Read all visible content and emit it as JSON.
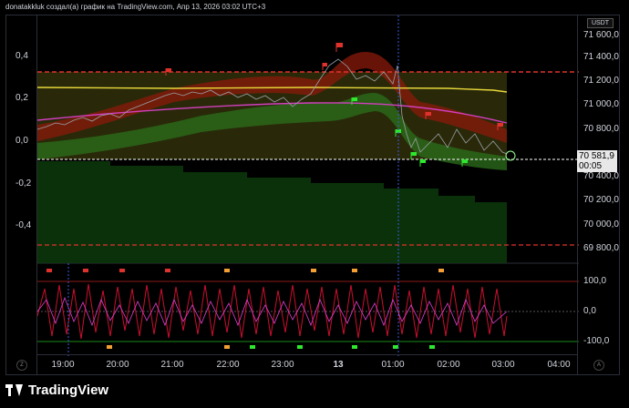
{
  "caption": "donatakkluk создал(а) график на TradingView.com, Апр 13, 2026 03:02 UTC+3",
  "currency": "USDT",
  "price_scale": [
    "71 600,0",
    "71 400,0",
    "71 200,0",
    "71 000,0",
    "70 800,0",
    "70 400,0",
    "70 200,0",
    "70 000,0",
    "69 800,0"
  ],
  "price_tag": {
    "price": "70 581,9",
    "countdown": "00:05"
  },
  "left_scale": [
    "0,4",
    "0,2",
    "0,0",
    "-0,2",
    "-0,4"
  ],
  "oscillator_scale": [
    "100,0",
    "0,0",
    "-100,0"
  ],
  "time_axis": [
    "19:00",
    "20:00",
    "21:00",
    "22:00",
    "23:00",
    "13",
    "01:00",
    "02:00",
    "03:00",
    "04:00"
  ],
  "corner_buttons": {
    "left": "Z",
    "right": "A"
  },
  "footer": {
    "brand": "TradingView"
  },
  "colors": {
    "background": "#000000",
    "upper_band": "#8b1a0a",
    "lower_band": "#2b6a1a",
    "deep_green": "#0c3a0c",
    "magenta_line": "#d13fbf",
    "yellow_line": "#e8d83a",
    "red_dashed": "#e0322c",
    "price_line": "#ffffff"
  },
  "icons": [
    "red-flag-icon",
    "green-flag-icon",
    "orange-flag-icon",
    "tradingview-logo-icon"
  ]
}
